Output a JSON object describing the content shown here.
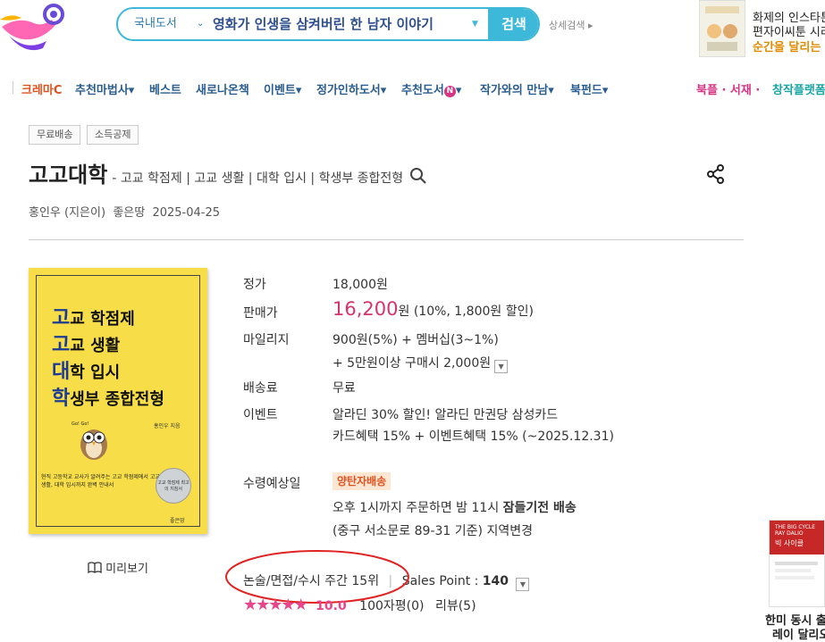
{
  "header": {
    "search": {
      "category": "국내도서",
      "query": "영화가 인생을 삼켜버린 한 남자 이야기",
      "button_label": "검색"
    },
    "advanced_search": "상세검색 ▸",
    "ad": {
      "line1": "화제의 인스타툰",
      "line2": "편자이씨툰 시리",
      "line3": "순간을 달리는 할"
    }
  },
  "nav": {
    "items": [
      {
        "label": "크레마C"
      },
      {
        "label": "추천마법사▾"
      },
      {
        "label": "베스트"
      },
      {
        "label": "새로나온책"
      },
      {
        "label": "이벤트▾"
      },
      {
        "label": "정가인하도서▾"
      },
      {
        "label": "추천도서",
        "badge": "N",
        "suffix": "▾"
      },
      {
        "label": "작가와의 만남▾"
      },
      {
        "label": "북펀드▾"
      }
    ],
    "right": [
      "북플 · 서재 ·",
      "창작플랫폼"
    ],
    "colors": {
      "link": "#2a5d8f",
      "crema": "#e0521f",
      "bookple": "#d63384",
      "platform": "#1aa5a5"
    }
  },
  "book": {
    "tags": [
      "무료배송",
      "소득공제"
    ],
    "title": "고고대학",
    "subtitle": "- 고교 학점제 | 고교 생활 | 대학 입시 | 학생부 종합전형",
    "author": "홍인우 (지은이)",
    "publisher": "좋은땅",
    "date": "2025-04-25",
    "cover": {
      "lines": [
        {
          "accent": "고",
          "rest": "교 학점제"
        },
        {
          "accent": "고",
          "rest": "교 생활"
        },
        {
          "accent": "대",
          "rest": "학 입시"
        },
        {
          "accent": "학",
          "rest": "생부 종합전형"
        }
      ],
      "author": "홍인우 지음",
      "owl_text": "Go! Go!",
      "blurb": "현직 고등학교 교사가 알려주는 고교 학점제에서 고교 생활, 대학 입시까지 완벽 안내서",
      "seal": "고교 학점제 최고의 지침서",
      "publisher": "좋은땅",
      "color": "#f7de48"
    },
    "preview": "미리보기",
    "info": {
      "list_price_label": "정가",
      "list_price": "18,000원",
      "sale_price_label": "판매가",
      "sale_price": "16,200",
      "sale_price_unit": "원",
      "discount": "(10%, 1,800원 할인)",
      "mileage_label": "마일리지",
      "mileage": "900원(5%) + 멤버십(3~1%)",
      "mileage_extra": "+ 5만원이상 구매시 2,000원",
      "shipping_label": "배송료",
      "shipping": "무료",
      "event_label": "이벤트",
      "event_line1": "알라딘 30% 할인! 알라딘 만권당 삼성카드",
      "event_line2": "카드혜택 15% + 이벤트혜택 15% (~2025.12.31)",
      "delivery_label": "수령예상일",
      "delivery_badge": "양탄자배송",
      "delivery_line1_pre": "오후 1시까지 주문하면 밤 11시 ",
      "delivery_line1_bold": "잠들기전 배송",
      "delivery_line2": "(중구 서소문로 89-31 기준) 지역변경",
      "rank": "논술/면접/수시 주간 15위",
      "sales_point_label": "Sales Point :",
      "sales_point": "140",
      "rating": "10.0",
      "reviews_short": "100자평(0)",
      "reviews": "리뷰(5)"
    }
  },
  "side_ad": {
    "title": "THE BIG CYCLE",
    "author": "RAY DALIO",
    "book": "빅 사이클",
    "caption1": "한미 동시 출",
    "caption2": "레이 달리오"
  }
}
